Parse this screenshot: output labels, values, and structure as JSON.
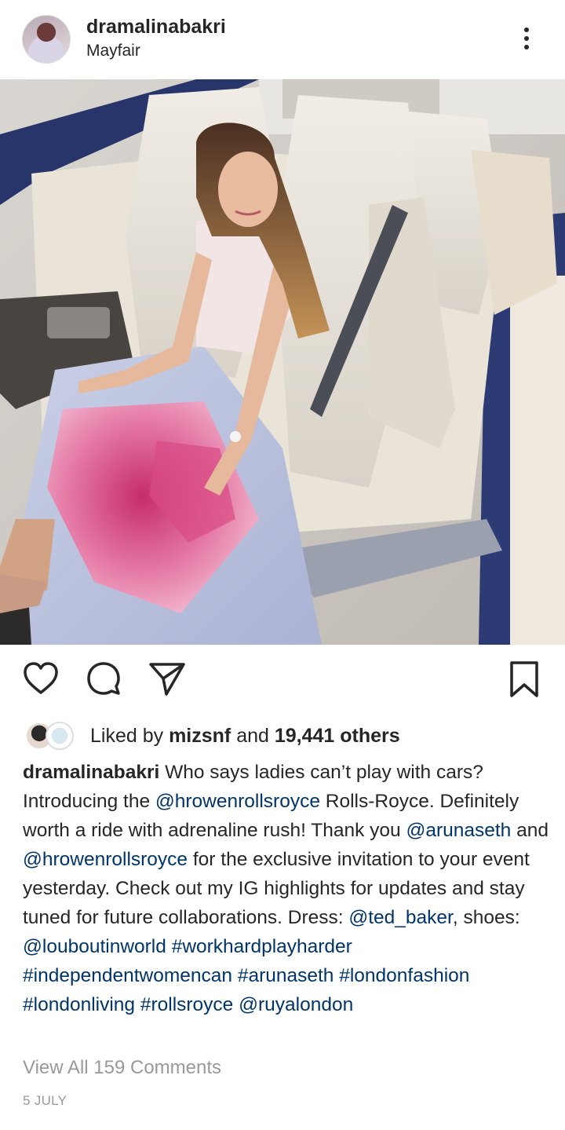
{
  "post": {
    "username": "dramalinabakri",
    "location": "Mayfair",
    "liked_prefix": "Liked by ",
    "liked_user": "mizsnf",
    "liked_and": " and ",
    "liked_count": "19,441 others",
    "caption": {
      "author": "dramalinabakri",
      "t1": " Who says ladies can’t play with cars? Introducing the ",
      "m1": "@hrowenrollsroyce",
      "t2": " Rolls-Royce. Definitely worth a ride with adrenaline rush! Thank you ",
      "m2": "@arunaseth",
      "t3": " and ",
      "m3": "@hrowenrollsroyce",
      "t4": " for the exclusive invitation to your event yesterday. Check out my IG highlights for updates and stay tuned for future collaborations. Dress: ",
      "m4": "@ted_baker",
      "t5": ", shoes: ",
      "m5": "@louboutinworld",
      "h1": "#workhardplayharder",
      "h2": "#independentwomencan",
      "h3": "#arunaseth",
      "h4": "#londonfashion",
      "h5": "#londonliving",
      "h6": "#rollsroyce",
      "m6": "@ruyalondon"
    },
    "view_all": "View All 159 Comments",
    "date": "5 JULY"
  },
  "icons": {
    "more": "more-vertical-icon",
    "like": "heart-icon",
    "comment": "comment-icon",
    "share": "send-icon",
    "save": "bookmark-icon"
  },
  "colors": {
    "text": "#262626",
    "link": "#003569",
    "muted": "#999999"
  }
}
